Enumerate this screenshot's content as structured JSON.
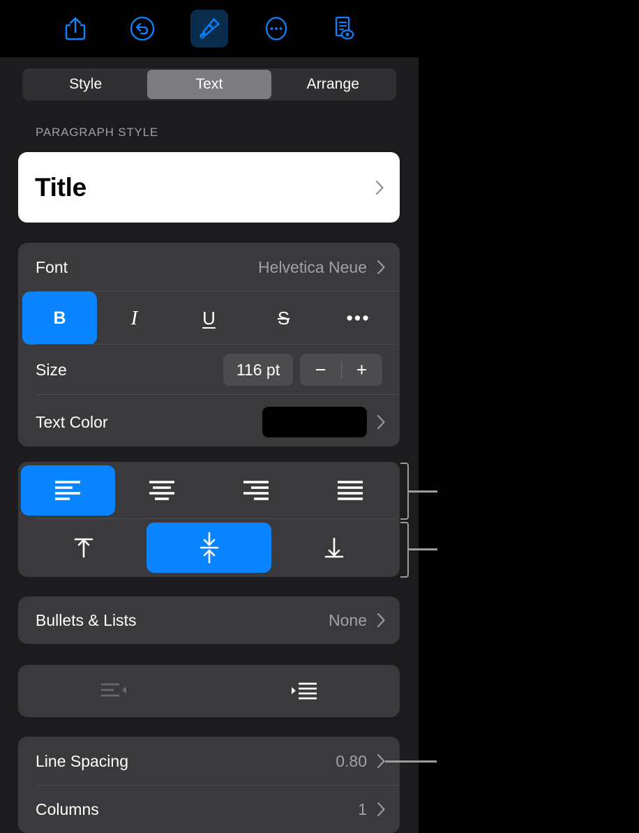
{
  "toolbar": {
    "items": [
      {
        "name": "share-icon",
        "label": "Share",
        "active": false
      },
      {
        "name": "undo-icon",
        "label": "Undo",
        "active": false
      },
      {
        "name": "format-brush-icon",
        "label": "Format",
        "active": true
      },
      {
        "name": "more-icon",
        "label": "More",
        "active": false
      },
      {
        "name": "document-view-icon",
        "label": "Document Options",
        "active": false
      }
    ]
  },
  "segmented": {
    "options": [
      "Style",
      "Text",
      "Arrange"
    ],
    "selected": "Text"
  },
  "paragraph_style": {
    "section_label": "PARAGRAPH STYLE",
    "value": "Title"
  },
  "font": {
    "label": "Font",
    "value": "Helvetica Neue",
    "styles": [
      {
        "name": "bold-button",
        "glyph": "B",
        "active": true
      },
      {
        "name": "italic-button",
        "glyph": "I",
        "active": false
      },
      {
        "name": "underline-button",
        "glyph": "U",
        "active": false
      },
      {
        "name": "strikethrough-button",
        "glyph": "S",
        "active": false
      },
      {
        "name": "more-text-options-button",
        "glyph": "•••",
        "active": false
      }
    ],
    "size": {
      "label": "Size",
      "value": "116 pt",
      "decrease": "−",
      "increase": "+"
    },
    "text_color": {
      "label": "Text Color",
      "swatch_hex": "#000000"
    }
  },
  "alignment": {
    "horizontal": [
      {
        "name": "align-left-button",
        "label": "Align Left",
        "active": true
      },
      {
        "name": "align-center-button",
        "label": "Align Center",
        "active": false
      },
      {
        "name": "align-right-button",
        "label": "Align Right",
        "active": false
      },
      {
        "name": "align-justify-button",
        "label": "Justify",
        "active": false
      }
    ],
    "vertical": [
      {
        "name": "align-top-button",
        "label": "Align Top",
        "active": false
      },
      {
        "name": "align-middle-button",
        "label": "Align Middle",
        "active": true
      },
      {
        "name": "align-bottom-button",
        "label": "Align Bottom",
        "active": false
      }
    ]
  },
  "bullets": {
    "label": "Bullets & Lists",
    "value": "None"
  },
  "indent": {
    "decrease": {
      "name": "decrease-indent-button",
      "label": "Decrease Indent",
      "enabled": false
    },
    "increase": {
      "name": "increase-indent-button",
      "label": "Increase Indent",
      "enabled": true
    }
  },
  "spacing": {
    "line_spacing": {
      "label": "Line Spacing",
      "value": "0.80"
    },
    "columns": {
      "label": "Columns",
      "value": "1"
    }
  },
  "colors": {
    "accent": "#0a84ff",
    "panel_bg": "#1c1c1e",
    "card_bg": "#3a3a3c",
    "toolbar_bg": "#000000",
    "callout": "#9c9c9c"
  }
}
